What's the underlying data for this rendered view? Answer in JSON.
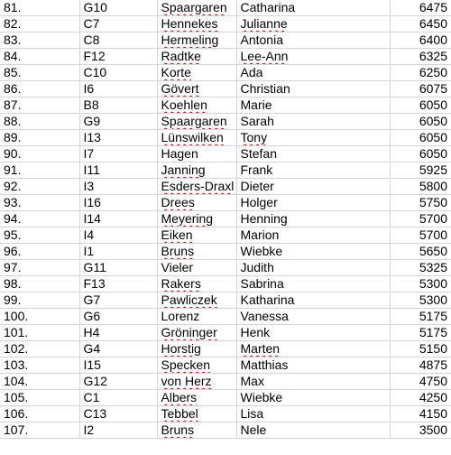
{
  "sheet": {
    "rows": [
      {
        "rank": "81.",
        "code": "G10",
        "surname": "Spaargaren",
        "firstname": "Catharina",
        "score": "6475",
        "surname_flag": true,
        "firstname_flag": false
      },
      {
        "rank": "82.",
        "code": "C7",
        "surname": "Hennekes",
        "firstname": "Julianne",
        "score": "6450",
        "surname_flag": true,
        "firstname_flag": true
      },
      {
        "rank": "83.",
        "code": "C8",
        "surname": "Hermeling",
        "firstname": "Antonia",
        "score": "6400",
        "surname_flag": true,
        "firstname_flag": false
      },
      {
        "rank": "84.",
        "code": "F12",
        "surname": "Radtke",
        "firstname": "Lee-Ann",
        "score": "6325",
        "surname_flag": true,
        "firstname_flag": true
      },
      {
        "rank": "85.",
        "code": "C10",
        "surname": "Korte",
        "firstname": "Ada",
        "score": "6250",
        "surname_flag": true,
        "firstname_flag": false
      },
      {
        "rank": "86.",
        "code": "I6",
        "surname": "Gövert",
        "firstname": "Christian",
        "score": "6075",
        "surname_flag": true,
        "firstname_flag": false
      },
      {
        "rank": "87.",
        "code": "B8",
        "surname": "Koehlen",
        "firstname": "Marie",
        "score": "6050",
        "surname_flag": true,
        "firstname_flag": false
      },
      {
        "rank": "88.",
        "code": "G9",
        "surname": "Spaargaren",
        "firstname": "Sarah",
        "score": "6050",
        "surname_flag": true,
        "firstname_flag": false
      },
      {
        "rank": "89.",
        "code": "I13",
        "surname": "Lünswilken",
        "firstname": "Tony",
        "score": "6050",
        "surname_flag": true,
        "firstname_flag": true
      },
      {
        "rank": "90.",
        "code": "I7",
        "surname": "Hagen",
        "firstname": "Stefan",
        "score": "6050",
        "surname_flag": false,
        "firstname_flag": false
      },
      {
        "rank": "91.",
        "code": "I11",
        "surname": "Janning",
        "firstname": "Frank",
        "score": "5925",
        "surname_flag": true,
        "firstname_flag": false
      },
      {
        "rank": "92.",
        "code": "I3",
        "surname": "Esders-Draxl",
        "firstname": "Dieter",
        "score": "5800",
        "surname_flag": true,
        "firstname_flag": false
      },
      {
        "rank": "93.",
        "code": "I16",
        "surname": "Drees",
        "firstname": "Holger",
        "score": "5750",
        "surname_flag": true,
        "firstname_flag": false
      },
      {
        "rank": "94.",
        "code": "I14",
        "surname": "Meyering",
        "firstname": "Henning",
        "score": "5700",
        "surname_flag": true,
        "firstname_flag": false
      },
      {
        "rank": "95.",
        "code": "I4",
        "surname": "Eiken",
        "firstname": "Marion",
        "score": "5700",
        "surname_flag": true,
        "firstname_flag": false
      },
      {
        "rank": "96.",
        "code": "I1",
        "surname": "Bruns",
        "firstname": "Wiebke",
        "score": "5650",
        "surname_flag": true,
        "firstname_flag": false
      },
      {
        "rank": "97.",
        "code": "G11",
        "surname": "Vieler",
        "firstname": "Judith",
        "score": "5325",
        "surname_flag": false,
        "firstname_flag": false
      },
      {
        "rank": "98.",
        "code": "F13",
        "surname": "Rakers",
        "firstname": "Sabrina",
        "score": "5300",
        "surname_flag": true,
        "firstname_flag": false
      },
      {
        "rank": "99.",
        "code": "G7",
        "surname": "Pawliczek",
        "firstname": "Katharina",
        "score": "5300",
        "surname_flag": true,
        "firstname_flag": false
      },
      {
        "rank": "100.",
        "code": "G6",
        "surname": "Lorenz",
        "firstname": "Vanessa",
        "score": "5175",
        "surname_flag": false,
        "firstname_flag": false
      },
      {
        "rank": "101.",
        "code": "H4",
        "surname": "Gröninger",
        "firstname": "Henk",
        "score": "5175",
        "surname_flag": true,
        "firstname_flag": false
      },
      {
        "rank": "102.",
        "code": "G4",
        "surname": "Horstig",
        "firstname": "Marten",
        "score": "5150",
        "surname_flag": true,
        "firstname_flag": true
      },
      {
        "rank": "103.",
        "code": "I15",
        "surname": "Specken",
        "firstname": "Matthias",
        "score": "4875",
        "surname_flag": true,
        "firstname_flag": false
      },
      {
        "rank": "104.",
        "code": "G12",
        "surname": "von Herz",
        "firstname": "Max",
        "score": "4750",
        "surname_flag": true,
        "firstname_flag": false
      },
      {
        "rank": "105.",
        "code": "C1",
        "surname": "Albers",
        "firstname": "Wiebke",
        "score": "4250",
        "surname_flag": true,
        "firstname_flag": false
      },
      {
        "rank": "106.",
        "code": "C13",
        "surname": "Tebbel",
        "firstname": "Lisa",
        "score": "4150",
        "surname_flag": true,
        "firstname_flag": false
      },
      {
        "rank": "107.",
        "code": "I2",
        "surname": "Bruns",
        "firstname": "Nele",
        "score": "3500",
        "surname_flag": true,
        "firstname_flag": false
      }
    ]
  },
  "colors": {
    "gridline": "#d4d4d4",
    "text": "#000000",
    "spellcheck_underline": "#c00000"
  }
}
